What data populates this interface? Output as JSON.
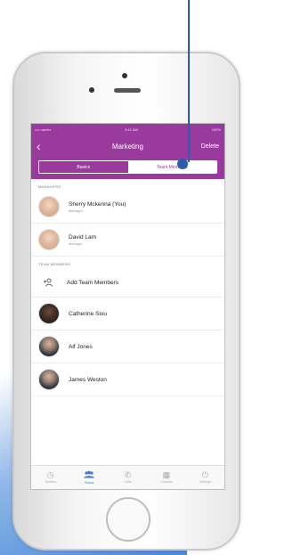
{
  "status_bar": {
    "carrier": "•••• carrier",
    "time": "9:41 AM",
    "battery": "100%"
  },
  "nav": {
    "back_icon": "‹",
    "title": "Marketing",
    "action": "Delete"
  },
  "segments": [
    {
      "label": "Basics",
      "state": "inactive"
    },
    {
      "label": "Team Members",
      "state": "active"
    }
  ],
  "sections": {
    "managers_header": "MANAGERS",
    "team_header": "TEAM MEMBERS"
  },
  "managers": [
    {
      "name": "Sherry Mckenna (You)",
      "role": "Manager"
    },
    {
      "name": "David Lam",
      "role": "Manager"
    }
  ],
  "add_member": {
    "icon": "add-user-icon",
    "label": "Add Team Members"
  },
  "members": [
    {
      "name": "Catherine Siou"
    },
    {
      "name": "Alf Jones"
    },
    {
      "name": "James Weston"
    }
  ],
  "tabs": [
    {
      "label": "Timeline",
      "icon": "clock-icon"
    },
    {
      "label": "Teams",
      "icon": "team-icon",
      "active": true
    },
    {
      "label": "Calls",
      "icon": "phone-icon"
    },
    {
      "label": "Contacts",
      "icon": "list-icon"
    },
    {
      "label": "Settings",
      "icon": "power-icon"
    }
  ],
  "colors": {
    "accent": "#9b3a9e",
    "tab_active": "#3a7bd5",
    "callout": "#2a5db0"
  }
}
